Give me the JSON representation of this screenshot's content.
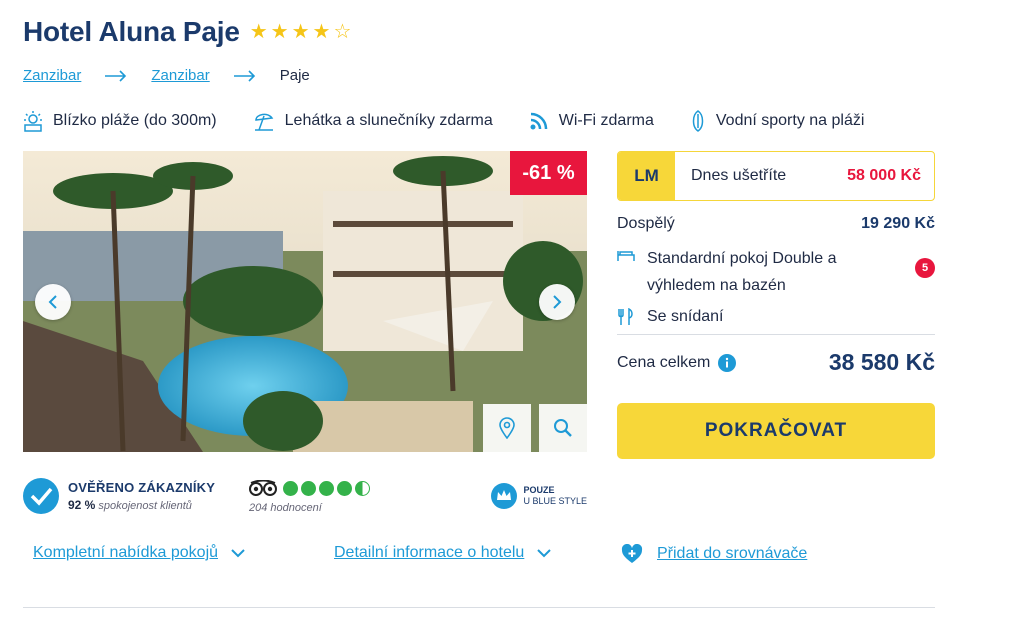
{
  "hotel": {
    "name": "Hotel Aluna Paje",
    "stars_full": 4,
    "stars_total": 5
  },
  "breadcrumb": [
    "Zanzibar",
    "Zanzibar",
    "Paje"
  ],
  "features": [
    {
      "icon": "beach-icon",
      "label": "Blízko pláže (do 300m)"
    },
    {
      "icon": "sunbed-icon",
      "label": "Lehátka a slunečníky zdarma"
    },
    {
      "icon": "wifi-icon",
      "label": "Wi-Fi zdarma"
    },
    {
      "icon": "surfboard-icon",
      "label": "Vodní sporty na pláži"
    }
  ],
  "gallery": {
    "discount": "-61 %"
  },
  "verified": {
    "title": "OVĚŘENO ZÁKAZNÍKY",
    "percent": "92 %",
    "subtitle": "spokojenost klientů"
  },
  "tripadvisor": {
    "rating": 4.5,
    "count": "204 hodnocení"
  },
  "blue_style": {
    "line1": "POUZE",
    "line2": "U BLUE STYLE"
  },
  "links": {
    "rooms": "Kompletní nabídka pokojů",
    "details": "Detailní informace o hotelu",
    "compare": "Přidat do srovnávače"
  },
  "pricing": {
    "lm_tag": "LM",
    "savings_label": "Dnes ušetříte",
    "savings_value": "58 000 Kč",
    "adults_label": "Dospělý",
    "adults_price": "19 290 Kč",
    "room": "Standardní pokoj Double a výhledem na bazén",
    "room_count": "5",
    "meal": "Se snídaní",
    "total_label": "Cena celkem",
    "total_price": "38 580 Kč",
    "cta": "POKRAČOVAT"
  },
  "colors": {
    "brand_navy": "#1b3a6b",
    "link_blue": "#1e9ad6",
    "accent_yellow": "#f7d739",
    "discount_red": "#e8163d",
    "tripadvisor_green": "#34b24a"
  }
}
